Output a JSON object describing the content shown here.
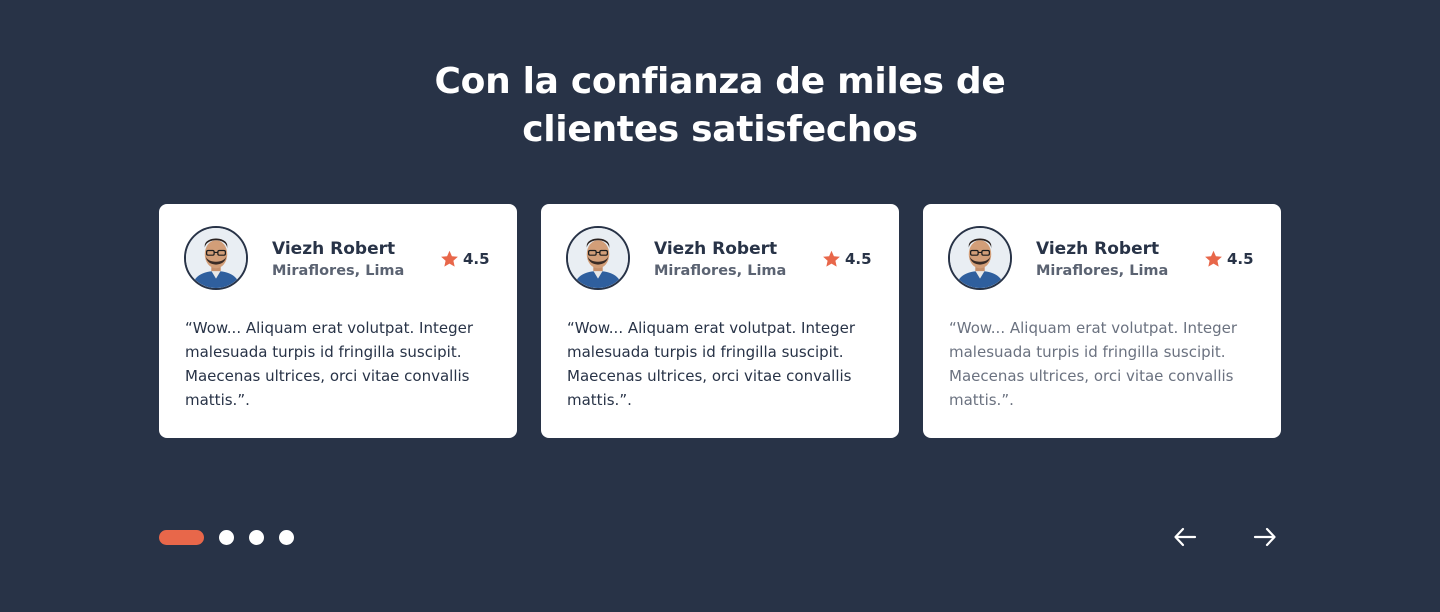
{
  "heading": {
    "line1": "Con la confianza de miles de",
    "line2": "clientes satisfechos"
  },
  "colors": {
    "background": "#283347",
    "card": "#ffffff",
    "accent": "#e8674a",
    "text": "#283347"
  },
  "testimonials": [
    {
      "name": "Viezh Robert",
      "location": "Miraflores, Lima",
      "rating": "4.5",
      "rating_icon": "star-icon",
      "quote": "“Wow... Aliquam erat volutpat. Integer malesuada turpis id fringilla suscipit. Maecenas ultrices, orci vitae convallis mattis.”."
    },
    {
      "name": "Viezh Robert",
      "location": "Miraflores, Lima",
      "rating": "4.5",
      "rating_icon": "star-icon",
      "quote": "“Wow... Aliquam erat volutpat. Integer malesuada turpis id fringilla suscipit. Maecenas ultrices, orci vitae convallis mattis.”."
    },
    {
      "name": "Viezh Robert",
      "location": "Miraflores, Lima",
      "rating": "4.5",
      "rating_icon": "star-icon",
      "quote": "“Wow... Aliquam erat volutpat. Integer malesuada turpis id fringilla suscipit. Maecenas ultrices, orci vitae convallis mattis.”."
    }
  ],
  "pagination": {
    "count": 4,
    "active_index": 0
  },
  "navigation": {
    "prev_icon": "arrow-left-icon",
    "next_icon": "arrow-right-icon"
  }
}
